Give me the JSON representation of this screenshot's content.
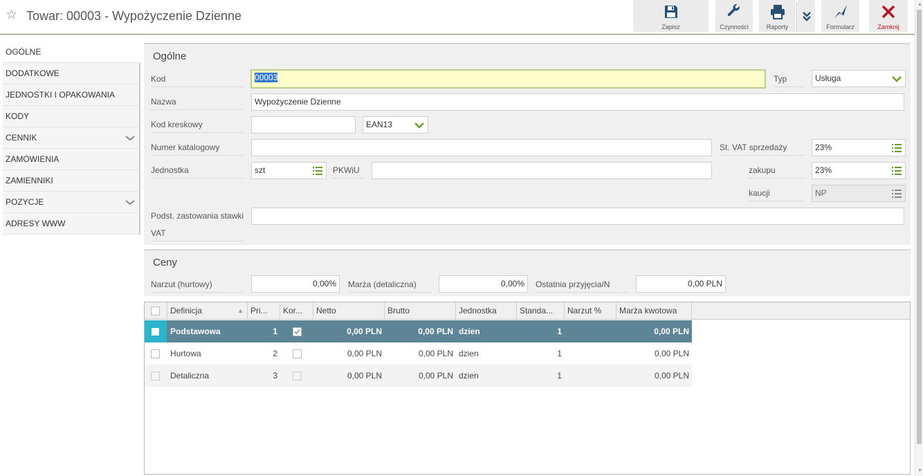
{
  "header": {
    "title": "Towar: 00003 - Wypożyczenie Dzienne",
    "star_icon": "star-icon",
    "toolbar": {
      "save": "Zapisz",
      "actions": "Czynności",
      "reports": "Raporty",
      "form": "Formularz",
      "close": "Zamknij"
    }
  },
  "sidebar": {
    "items": [
      {
        "label": "OGÓLNE"
      },
      {
        "label": "DODATKOWE"
      },
      {
        "label": "JEDNOSTKI I OPAKOWANIA"
      },
      {
        "label": "KODY"
      },
      {
        "label": "CENNIK"
      },
      {
        "label": "ZAMÓWIENIA"
      },
      {
        "label": "ZAMIENNIKI"
      },
      {
        "label": "POZYCJE"
      },
      {
        "label": "ADRESY WWW"
      }
    ]
  },
  "general": {
    "title": "Ogólne",
    "kod_label": "Kod",
    "kod_value": "00003",
    "typ_label": "Typ",
    "typ_value": "Usługa",
    "nazwa_label": "Nazwa",
    "nazwa_value": "Wypożyczenie Dzienne",
    "kod_kreskowy_label": "Kod kreskowy",
    "kod_kreskowy_value": "",
    "barcode_type": "EAN13",
    "numer_katalogowy_label": "Numer katalogowy",
    "numer_katalogowy_value": "",
    "vat_sales_label": "St. VAT sprzedaży",
    "vat_sales_value": "23%",
    "jednostka_label": "Jednostka",
    "jednostka_value": "szt",
    "pkwiu_label": "PKWiU",
    "pkwiu_value": "",
    "zakupu_label": "zakupu",
    "zakupu_value": "23%",
    "kaucji_label": "kaucji",
    "kaucji_value": "NP",
    "podst_label_1": "Podst. zastowania stawki",
    "podst_label_2": "VAT",
    "podst_value": ""
  },
  "prices": {
    "title": "Ceny",
    "narzut_label": "Narzut (hurtowy)",
    "narzut_value": "0,00%",
    "marza_label": "Marża (detaliczna)",
    "marza_value": "0,00%",
    "ostatnia_label": "Ostatnia przyjęcia/N",
    "ostatnia_value": "0,00 PLN"
  },
  "grid": {
    "columns": [
      "Definicja",
      "Pri...",
      "Kor...",
      "Netto",
      "Brutto",
      "Jednostka",
      "Standa...",
      "Narzut %",
      "Marża kwotowa"
    ],
    "rows": [
      {
        "definicja": "Podstawowa",
        "pri": "1",
        "kor": true,
        "netto": "0,00 PLN",
        "brutto": "0,00 PLN",
        "jednostka": "dzien",
        "standard": "1",
        "narzut": "",
        "marza": "0,00 PLN"
      },
      {
        "definicja": "Hurtowa",
        "pri": "2",
        "kor": false,
        "netto": "0,00 PLN",
        "brutto": "0,00 PLN",
        "jednostka": "dzien",
        "standard": "1",
        "narzut": "",
        "marza": "0,00 PLN"
      },
      {
        "definicja": "Detaliczna",
        "pri": "3",
        "kor": false,
        "netto": "0,00 PLN",
        "brutto": "0,00 PLN",
        "jednostka": "dzien",
        "standard": "1",
        "narzut": "",
        "marza": "0,00 PLN"
      }
    ]
  },
  "colors": {
    "accent_green": "#6a9c2b",
    "close_red": "#b8141f",
    "selected_row": "#5e8596",
    "toolbar_blue": "#264f73"
  }
}
